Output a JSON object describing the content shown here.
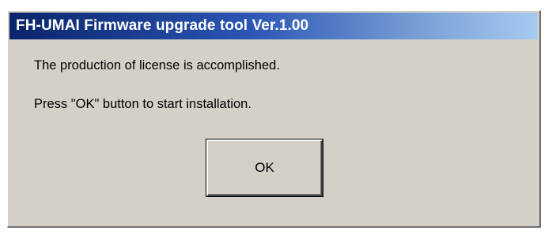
{
  "window": {
    "title": "FH-UMAI Firmware upgrade tool Ver.1.00"
  },
  "dialog": {
    "message_line1": "The production of license is accomplished.",
    "message_line2": "Press \"OK\" button to start installation.",
    "ok_label": "OK"
  },
  "colors": {
    "titlebar_start": "#0a246a",
    "titlebar_end": "#a6caf0",
    "dialog_face": "#d4d0c8"
  }
}
